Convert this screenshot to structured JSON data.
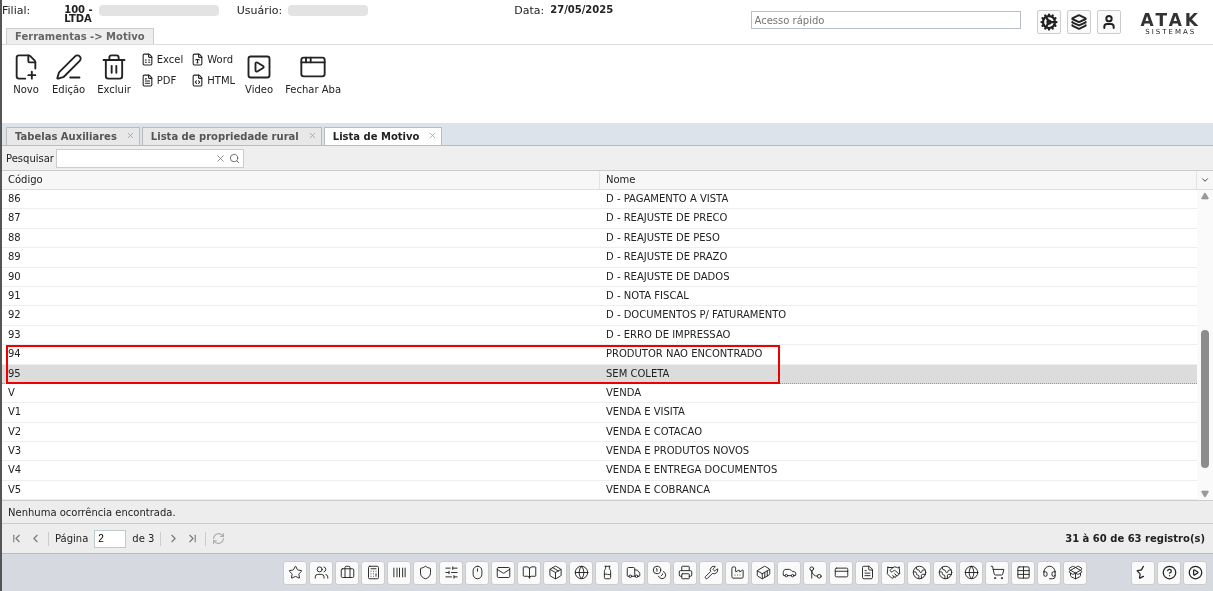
{
  "header": {
    "filial_label": "Filial:",
    "filial_value": "100 -",
    "filial_value_cut": "LTDA",
    "user_label": "Usuário:",
    "date_label": "Data:",
    "date_value": "27/05/2025",
    "quick_access": {
      "placeholder": "Acesso rápido"
    },
    "logo": "ATAK",
    "logo_sub": "SISTEMAS"
  },
  "breadcrumb_tab": "Ferramentas -> Motivo",
  "toolbar": [
    {
      "kind": "big",
      "label": "Novo"
    },
    {
      "kind": "big",
      "label": "Edição"
    },
    {
      "kind": "big",
      "label": "Excluir"
    },
    {
      "kind": "pair",
      "items": [
        {
          "label": "Excel"
        },
        {
          "label": "PDF"
        }
      ]
    },
    {
      "kind": "pair",
      "items": [
        {
          "label": "Word"
        },
        {
          "label": "HTML"
        }
      ]
    },
    {
      "kind": "big",
      "label": "Video"
    },
    {
      "kind": "big",
      "label": "Fechar Aba"
    }
  ],
  "tabs": [
    {
      "label": "Tabelas Auxiliares",
      "selected": false
    },
    {
      "label": "Lista de propriedade rural",
      "selected": false
    },
    {
      "label": "Lista de Motivo",
      "selected": true
    }
  ],
  "search": {
    "label": "Pesquisar"
  },
  "table": {
    "columns": [
      "Código",
      "Nome"
    ],
    "rows": [
      {
        "code": "86",
        "name": "D - PAGAMENTO A VISTA",
        "selected": false,
        "highlighted": false
      },
      {
        "code": "87",
        "name": "D - REAJUSTE DE PRECO",
        "selected": false,
        "highlighted": false
      },
      {
        "code": "88",
        "name": "D - REAJUSTE DE PESO",
        "selected": false,
        "highlighted": false
      },
      {
        "code": "89",
        "name": "D - REAJUSTE DE PRAZO",
        "selected": false,
        "highlighted": false
      },
      {
        "code": "90",
        "name": "D - REAJUSTE DE DADOS",
        "selected": false,
        "highlighted": false
      },
      {
        "code": "91",
        "name": "D - NOTA FISCAL",
        "selected": false,
        "highlighted": false
      },
      {
        "code": "92",
        "name": "D - DOCUMENTOS P/ FATURAMENTO",
        "selected": false,
        "highlighted": false
      },
      {
        "code": "93",
        "name": "D - ERRO DE IMPRESSAO",
        "selected": false,
        "highlighted": false
      },
      {
        "code": "94",
        "name": "PRODUTOR NAO ENCONTRADO",
        "selected": false,
        "highlighted": true
      },
      {
        "code": "95",
        "name": "SEM COLETA",
        "selected": true,
        "highlighted": true
      },
      {
        "code": "V",
        "name": "VENDA",
        "selected": false,
        "highlighted": false
      },
      {
        "code": "V1",
        "name": "VENDA E VISITA",
        "selected": false,
        "highlighted": false
      },
      {
        "code": "V2",
        "name": "VENDA E COTACAO",
        "selected": false,
        "highlighted": false
      },
      {
        "code": "V3",
        "name": "VENDA E PRODUTOS NOVOS",
        "selected": false,
        "highlighted": false
      },
      {
        "code": "V4",
        "name": "VENDA E ENTREGA DOCUMENTOS",
        "selected": false,
        "highlighted": false
      },
      {
        "code": "V5",
        "name": "VENDA E COBRANCA",
        "selected": false,
        "highlighted": false
      }
    ]
  },
  "status_message": "Nenhuma ocorrência encontrada.",
  "pager": {
    "page_label": "Página",
    "page_value": "2",
    "of_label": "de 3",
    "summary": "31 à 60 de 63 registro(s)"
  }
}
